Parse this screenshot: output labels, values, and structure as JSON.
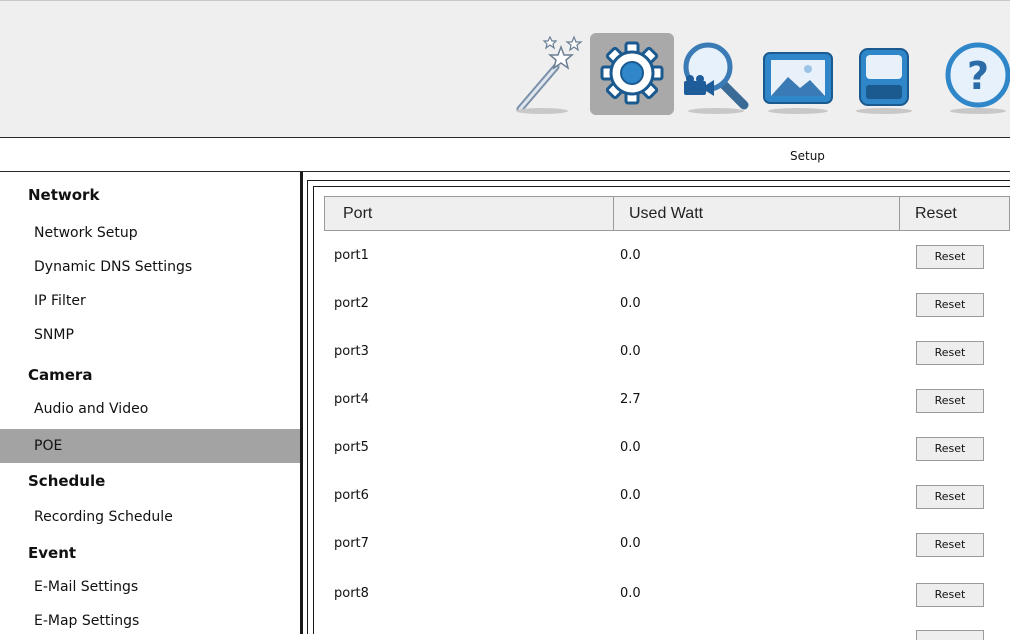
{
  "header": {
    "icons": [
      {
        "name": "wizard-wand-icon",
        "active": false
      },
      {
        "name": "setup-gear-icon",
        "active": true
      },
      {
        "name": "playback-search-icon",
        "active": false
      },
      {
        "name": "emap-image-icon",
        "active": false
      },
      {
        "name": "system-monitor-icon",
        "active": false
      },
      {
        "name": "help-icon",
        "active": false
      }
    ],
    "section_title": "Setup"
  },
  "sidebar": {
    "groups": [
      {
        "heading": "Network",
        "items": [
          "Network Setup",
          "Dynamic DNS Settings",
          "IP Filter",
          "SNMP"
        ]
      },
      {
        "heading": "Camera",
        "items": [
          "Audio and Video",
          "POE"
        ]
      },
      {
        "heading": "Schedule",
        "items": [
          "Recording Schedule"
        ]
      },
      {
        "heading": "Event",
        "items": [
          "E-Mail Settings",
          "E-Map Settings"
        ]
      }
    ],
    "active_item": "POE"
  },
  "table": {
    "columns": [
      "Port",
      "Used Watt",
      "Reset"
    ],
    "rows": [
      {
        "port": "port1",
        "watt": "0.0",
        "reset_label": "Reset"
      },
      {
        "port": "port2",
        "watt": "0.0",
        "reset_label": "Reset"
      },
      {
        "port": "port3",
        "watt": "0.0",
        "reset_label": "Reset"
      },
      {
        "port": "port4",
        "watt": "2.7",
        "reset_label": "Reset"
      },
      {
        "port": "port5",
        "watt": "0.0",
        "reset_label": "Reset"
      },
      {
        "port": "port6",
        "watt": "0.0",
        "reset_label": "Reset"
      },
      {
        "port": "port7",
        "watt": "0.0",
        "reset_label": "Reset"
      },
      {
        "port": "port8",
        "watt": "0.0",
        "reset_label": "Reset"
      }
    ]
  }
}
